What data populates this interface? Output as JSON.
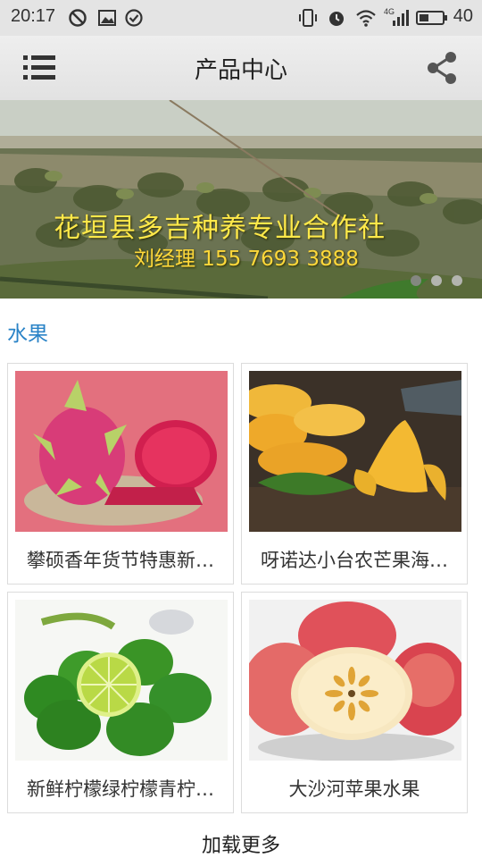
{
  "status_bar": {
    "time": "20:17",
    "battery": "40",
    "network": "4G"
  },
  "header": {
    "title": "产品中心"
  },
  "banner": {
    "caption": "花垣县多吉种养专业合作社",
    "contact": "刘经理 155 7693 3888",
    "page_count": 3,
    "active_page": 1
  },
  "section": {
    "title": "水果"
  },
  "products": [
    {
      "name": "攀硕香年货节特惠新…"
    },
    {
      "name": "呀诺达小台农芒果海…"
    },
    {
      "name": "新鲜柠檬绿柠檬青柠…"
    },
    {
      "name": "大沙河苹果水果"
    }
  ],
  "footer": {
    "load_more": "加载更多"
  }
}
